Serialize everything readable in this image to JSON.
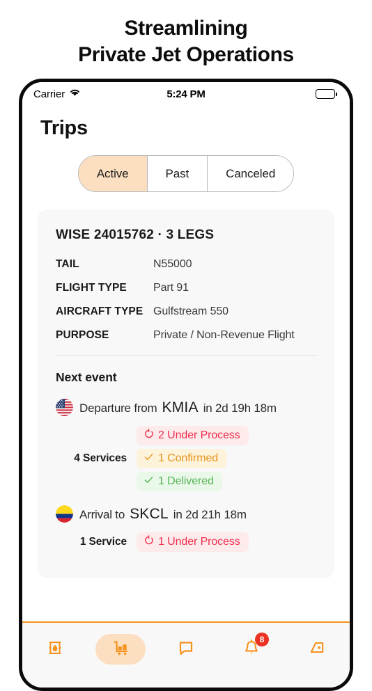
{
  "headline": {
    "line1": "Streamlining",
    "line2": "Private Jet Operations"
  },
  "status_bar": {
    "carrier": "Carrier",
    "wifi_icon": "wifi-icon",
    "time": "5:24 PM",
    "battery_icon": "battery-full-icon"
  },
  "screen": {
    "page_title": "Trips",
    "segments": [
      {
        "label": "Active",
        "selected": true
      },
      {
        "label": "Past",
        "selected": false
      },
      {
        "label": "Canceled",
        "selected": false
      }
    ],
    "trip_card": {
      "title": "WISE 24015762  ·  3 LEGS",
      "specs": [
        {
          "label": "TAIL",
          "value": "N55000"
        },
        {
          "label": "FLIGHT TYPE",
          "value": "Part 91"
        },
        {
          "label": "AIRCRAFT TYPE",
          "value": "Gulfstream 550"
        },
        {
          "label": "PURPOSE",
          "value": "Private / Non-Revenue Flight"
        }
      ],
      "next_event_title": "Next event",
      "events": [
        {
          "flag": "us-flag-icon",
          "action": "Departure from",
          "code": "KMIA",
          "eta": "in 2d 19h 18m",
          "services_count": "4 Services",
          "badges": [
            {
              "icon": "refresh-icon",
              "label": "2 Under Process",
              "style": "process"
            },
            {
              "icon": "check-icon",
              "label": "1 Confirmed",
              "style": "confirmed"
            },
            {
              "icon": "check-icon",
              "label": "1 Delivered",
              "style": "delivered"
            }
          ]
        },
        {
          "flag": "colombia-flag-icon",
          "action": "Arrival to",
          "code": "SKCL",
          "eta": "in 2d 21h 18m",
          "services_count": "1 Service",
          "badges": [
            {
              "icon": "refresh-icon",
              "label": "1 Under Process",
              "style": "process"
            }
          ]
        }
      ]
    },
    "tab_bar": {
      "accent_color": "#f7921e",
      "items": [
        {
          "icon": "fuel-barrel-icon",
          "selected": false,
          "badge": null
        },
        {
          "icon": "service-cart-icon",
          "selected": true,
          "badge": null
        },
        {
          "icon": "chat-bubble-icon",
          "selected": false,
          "badge": null
        },
        {
          "icon": "notification-bell-icon",
          "selected": false,
          "badge": "8"
        },
        {
          "icon": "aircraft-tail-icon",
          "selected": false,
          "badge": null
        }
      ]
    }
  }
}
